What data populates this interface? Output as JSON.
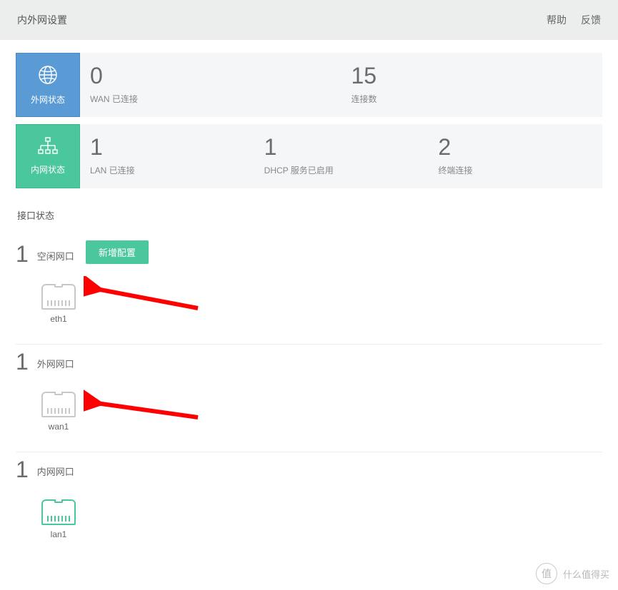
{
  "header": {
    "title": "内外网设置",
    "help_label": "帮助",
    "feedback_label": "反馈"
  },
  "wan_status": {
    "tile_label": "外网状态",
    "cells": [
      {
        "value": "0",
        "label": "WAN 已连接"
      },
      {
        "value": "15",
        "label": "连接数"
      }
    ]
  },
  "lan_status": {
    "tile_label": "内网状态",
    "cells": [
      {
        "value": "1",
        "label": "LAN 已连接"
      },
      {
        "value": "1",
        "label": "DHCP 服务已启用"
      },
      {
        "value": "2",
        "label": "终端连接"
      }
    ]
  },
  "section_port_status": "接口状态",
  "port_groups": {
    "idle": {
      "count": "1",
      "title": "空闲网口",
      "add_button_label": "新增配置",
      "port_name": "eth1"
    },
    "wan": {
      "count": "1",
      "title": "外网网口",
      "port_name": "wan1"
    },
    "lan": {
      "count": "1",
      "title": "内网网口",
      "port_name": "lan1"
    }
  },
  "watermark": {
    "icon_char": "值",
    "text": "什么值得买"
  }
}
